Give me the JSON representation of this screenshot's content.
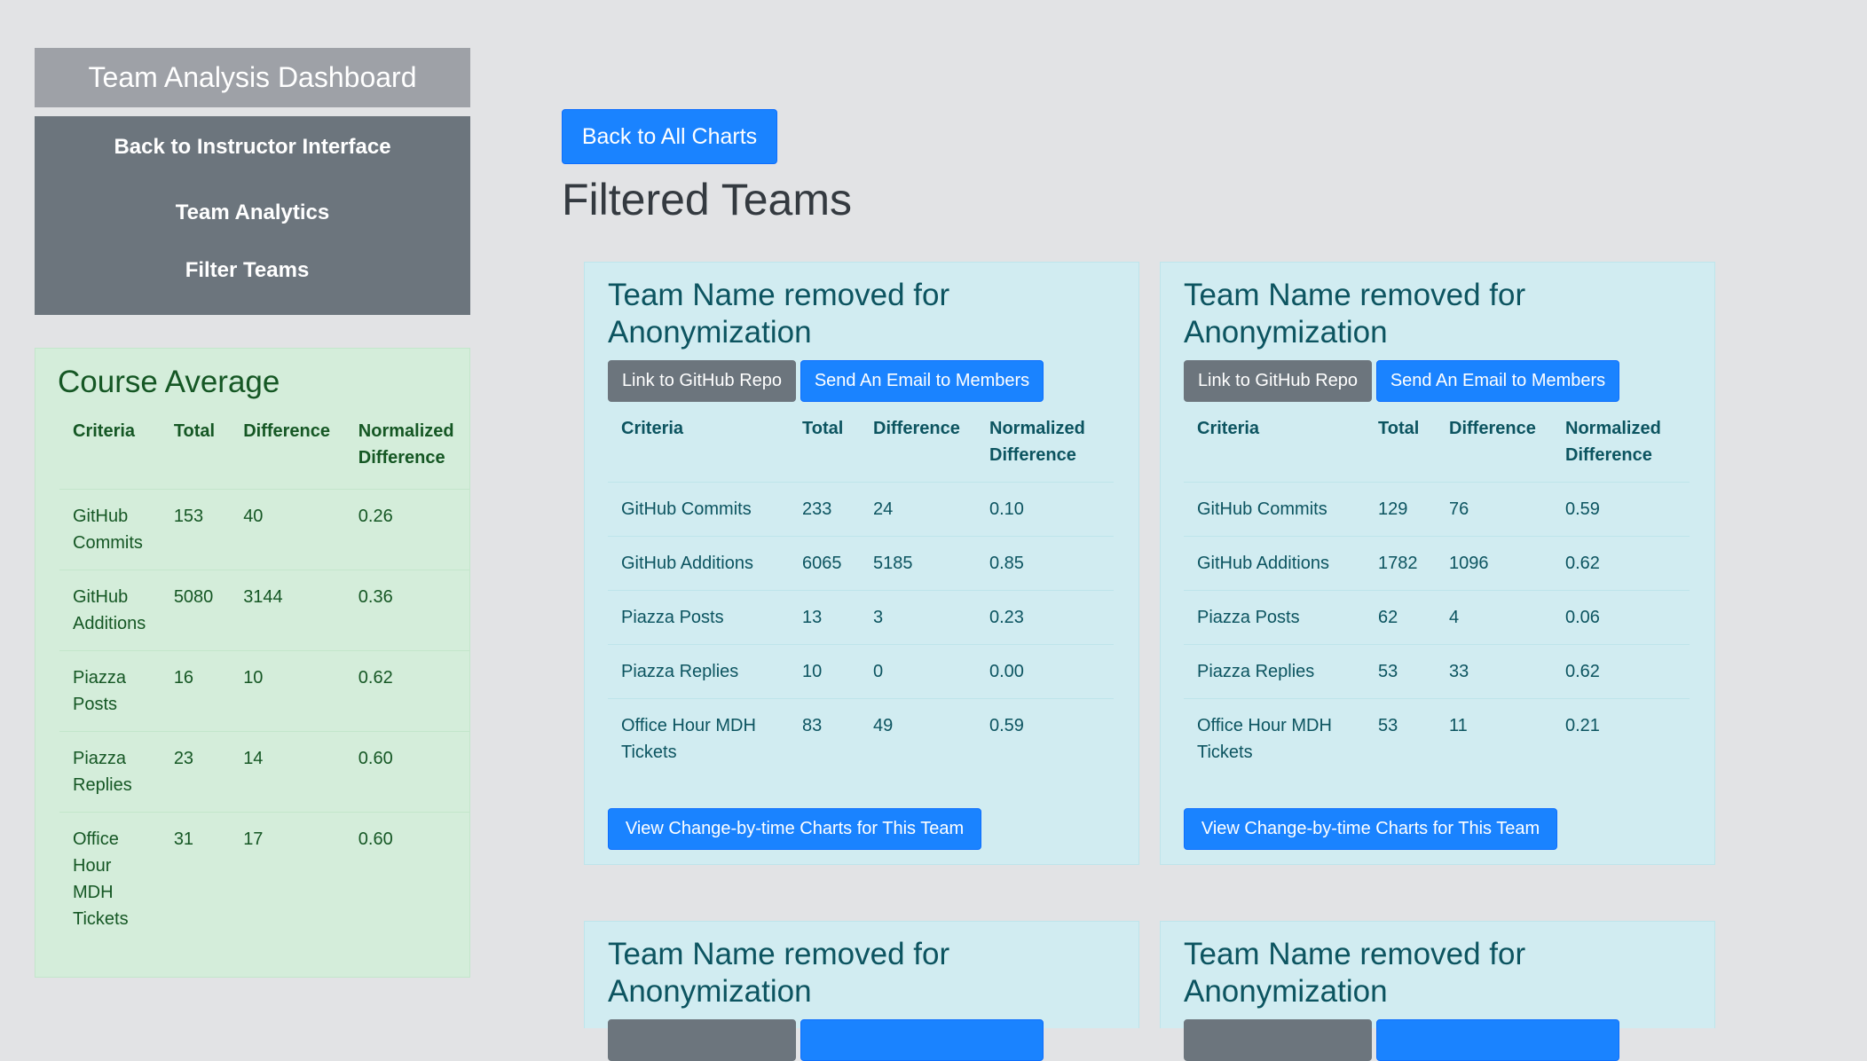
{
  "sidebar": {
    "title": "Team Analysis Dashboard",
    "nav": [
      "Back to Instructor Interface",
      "Team Analytics",
      "Filter Teams"
    ]
  },
  "course_average": {
    "title": "Course Average",
    "headers": [
      "Criteria",
      "Total",
      "Difference",
      "Normalized Difference"
    ],
    "rows": [
      [
        "GitHub Commits",
        "153",
        "40",
        "0.26"
      ],
      [
        "GitHub Additions",
        "5080",
        "3144",
        "0.36"
      ],
      [
        "Piazza Posts",
        "16",
        "10",
        "0.62"
      ],
      [
        "Piazza Replies",
        "23",
        "14",
        "0.60"
      ],
      [
        "Office Hour MDH Tickets",
        "31",
        "17",
        "0.60"
      ]
    ]
  },
  "main": {
    "back_button": "Back to All Charts",
    "page_title": "Filtered Teams",
    "teams": [
      {
        "name": "Team Name removed for Anonymization",
        "github_button": "Link to GitHub Repo",
        "email_button": "Send An Email to Members",
        "headers": [
          "Criteria",
          "Total",
          "Difference",
          "Normalized Difference"
        ],
        "rows": [
          [
            "GitHub Commits",
            "233",
            "24",
            "0.10"
          ],
          [
            "GitHub Additions",
            "6065",
            "5185",
            "0.85"
          ],
          [
            "Piazza Posts",
            "13",
            "3",
            "0.23"
          ],
          [
            "Piazza Replies",
            "10",
            "0",
            "0.00"
          ],
          [
            "Office Hour MDH Tickets",
            "83",
            "49",
            "0.59"
          ]
        ],
        "view_button": "View Change-by-time Charts for This Team"
      },
      {
        "name": "Team Name removed for Anonymization",
        "github_button": "Link to GitHub Repo",
        "email_button": "Send An Email to Members",
        "headers": [
          "Criteria",
          "Total",
          "Difference",
          "Normalized Difference"
        ],
        "rows": [
          [
            "GitHub Commits",
            "129",
            "76",
            "0.59"
          ],
          [
            "GitHub Additions",
            "1782",
            "1096",
            "0.62"
          ],
          [
            "Piazza Posts",
            "62",
            "4",
            "0.06"
          ],
          [
            "Piazza Replies",
            "53",
            "33",
            "0.62"
          ],
          [
            "Office Hour MDH Tickets",
            "53",
            "11",
            "0.21"
          ]
        ],
        "view_button": "View Change-by-time Charts for This Team"
      },
      {
        "name": "Team Name removed for Anonymization"
      },
      {
        "name": "Team Name removed for Anonymization"
      }
    ]
  }
}
